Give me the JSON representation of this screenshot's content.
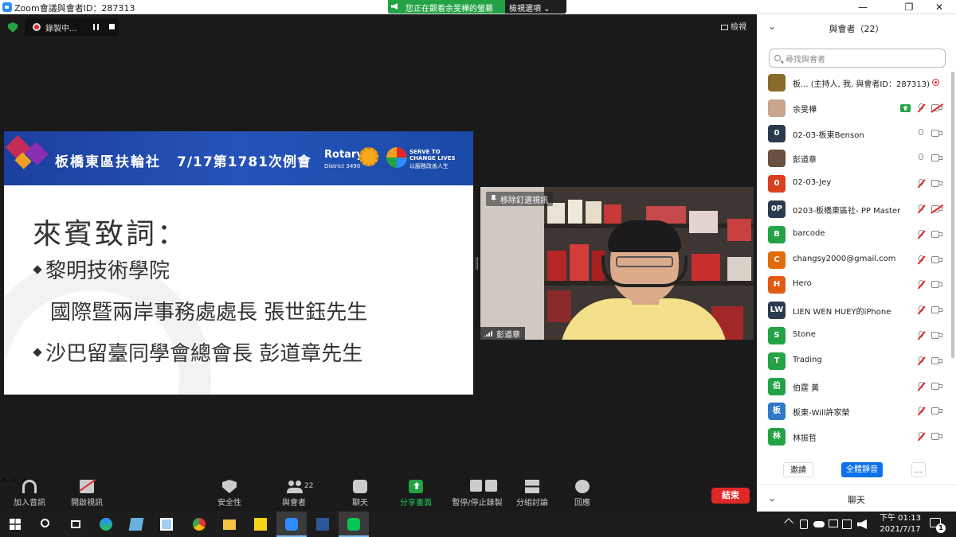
{
  "window": {
    "title": "Zoom會議與會者ID：287313",
    "minimize": "—",
    "maximize": "❐",
    "close": "✕"
  },
  "share_banner": {
    "viewing_text": "您正在觀看余旻樺的螢幕",
    "view_options": "檢視選項 ⌄"
  },
  "recording": {
    "label": "錄製中..."
  },
  "view_button": "檢視",
  "slide": {
    "club": "板橋東區扶輪社",
    "meeting": "7/17第1781次例會",
    "rotary": "Rotary",
    "district": "District 3490",
    "serve1": "SERVE TO",
    "serve2": "CHANGE LIVES",
    "serve3": "以服務改善人生",
    "heading": "來賓致詞：",
    "lines": [
      "黎明技術學院",
      "國際暨兩岸事務處處長 張世鈺先生",
      "沙巴留臺同學會總會長 彭道章先生"
    ]
  },
  "video": {
    "pin_label": "移除釘選視訊",
    "name_label": "彭道章"
  },
  "toolbar": {
    "audio": "加入音訊",
    "video": "開啟視訊",
    "security": "安全性",
    "participants": "與會者",
    "participants_count": "22",
    "chat": "聊天",
    "share": "分享畫面",
    "record": "暫停/停止錄製",
    "breakout": "分組討論",
    "reactions": "回應",
    "end": "結束",
    "caret": "^"
  },
  "panel": {
    "title": "與會者（22）",
    "chevron": "⌄",
    "search_placeholder": "尋找與會者",
    "invite": "邀請",
    "mute_all": "全體靜音",
    "more": "...",
    "chat_title": "聊天",
    "participants": [
      {
        "avatar": "",
        "name": "板...  (主持人, 我, 與會者ID：287313)",
        "color": "#8a6a2a"
      },
      {
        "avatar": "",
        "name": "余旻樺",
        "color": "#c9a58c"
      },
      {
        "avatar": "0",
        "name": "02-03-板東Benson",
        "color": "#2b3a4d"
      },
      {
        "avatar": "",
        "name": "彭道章",
        "color": "#6a5040"
      },
      {
        "avatar": "0",
        "name": "02-03-Jey",
        "color": "#d9411e"
      },
      {
        "avatar": "0P",
        "name": "0203-板橋東區社- PP Master",
        "color": "#2b3a4d"
      },
      {
        "avatar": "B",
        "name": "barcode",
        "color": "#23a345"
      },
      {
        "avatar": "C",
        "name": "changsy2000@gmail.com",
        "color": "#e06c0a"
      },
      {
        "avatar": "H",
        "name": "Hero",
        "color": "#e05a12"
      },
      {
        "avatar": "LW",
        "name": "LIEN WEN HUEY的iPhone",
        "color": "#2b3a4d"
      },
      {
        "avatar": "S",
        "name": "Stone",
        "color": "#23a345"
      },
      {
        "avatar": "T",
        "name": "Trading",
        "color": "#23a345"
      },
      {
        "avatar": "伯",
        "name": "伯霆 黃",
        "color": "#23a345"
      },
      {
        "avatar": "板",
        "name": "板東-Will許家榮",
        "color": "#2f79c9"
      },
      {
        "avatar": "林",
        "name": "林振哲",
        "color": "#23a345"
      }
    ]
  },
  "taskbar": {
    "clock_time": "下午 01:13",
    "clock_date": "2021/7/17",
    "notif_count": "1"
  },
  "colors": {
    "accent": "#2d8cff",
    "green": "#23a345",
    "end_red": "#e02828"
  }
}
